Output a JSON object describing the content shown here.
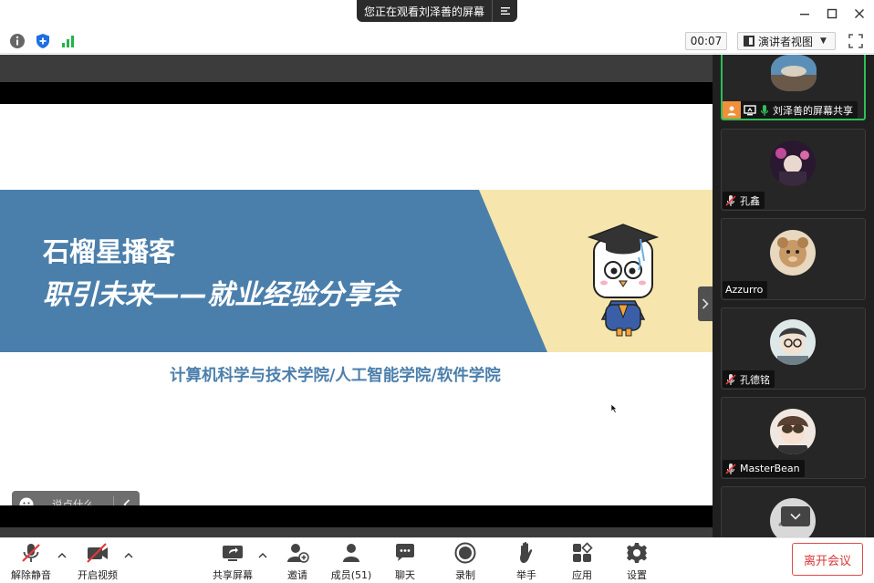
{
  "titlebar": {
    "share_banner": "您正在观看刘泽善的屏幕",
    "menu_icon": "list-menu-icon",
    "minimize_icon": "minimize-icon",
    "maximize_icon": "maximize-icon",
    "close_icon": "close-icon"
  },
  "statusbar": {
    "icons": [
      "info-icon",
      "shield-icon",
      "signal-bars-icon"
    ],
    "timer": "00:07",
    "view_mode": "演讲者视图",
    "fullscreen_icon": "fullscreen-icon"
  },
  "slide": {
    "title_line1": "石榴星播客",
    "title_line2": "职引未来——就业经验分享会",
    "subtitle": "计算机科学与技术学院/人工智能学院/软件学院",
    "colors": {
      "blue_band": "#4b7fab",
      "yellow_band": "#f6e6ad"
    }
  },
  "chat": {
    "placeholder": "说点什么..."
  },
  "gallery": {
    "participants": [
      {
        "name": "刘泽善的屏幕共享",
        "muted": false,
        "active": true
      },
      {
        "name": "孔鑫",
        "muted": true
      },
      {
        "name": "Azzurro",
        "muted": false
      },
      {
        "name": "孔德铭",
        "muted": true
      },
      {
        "name": "MasterBean",
        "muted": true
      }
    ]
  },
  "toolbar": {
    "unmute": "解除静音",
    "start_video": "开启视频",
    "share_screen": "共享屏幕",
    "invite": "邀请",
    "members": "成员(51)",
    "chat": "聊天",
    "record": "录制",
    "raise_hand": "举手",
    "apps": "应用",
    "settings": "设置",
    "leave": "离开会议"
  },
  "colors": {
    "accent_green": "#2fbe5a",
    "leave_red": "#d93636"
  }
}
